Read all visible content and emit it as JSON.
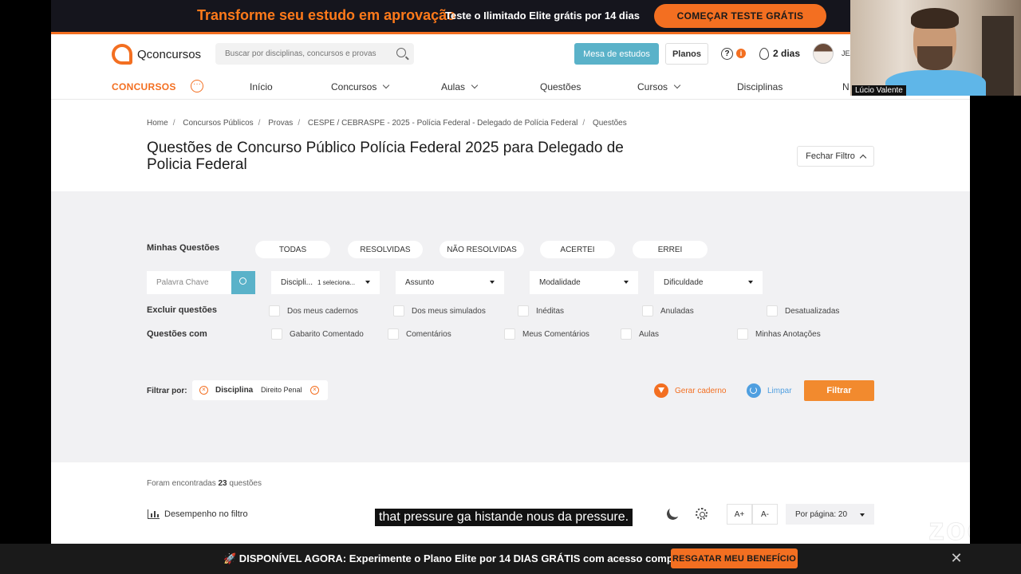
{
  "promo": {
    "title": "Transforme seu estudo em aprovação",
    "subtitle": "Teste o Ilimitado Elite grátis por 14 dias",
    "button": "COMEÇAR TESTE GRÁTIS"
  },
  "header": {
    "logo": "Qconcursos",
    "search_placeholder": "Buscar por disciplinas, concursos e provas",
    "mesa_button": "Mesa de estudos",
    "planos_button": "Planos",
    "streak": "2 dias",
    "user": "JEA"
  },
  "nav": {
    "active": "CONCURSOS",
    "items": [
      "Início",
      "Concursos",
      "Aulas",
      "Questões",
      "Cursos",
      "Disciplinas",
      "N"
    ]
  },
  "breadcrumb": [
    "Home",
    "Concursos Públicos",
    "Provas",
    "CESPE / CEBRASPE - 2025 - Polícia Federal - Delegado de Polícia Federal",
    "Questões"
  ],
  "page_title": "Questões de Concurso Público Polícia Federal 2025 para Delegado de Policia Federal",
  "fechar_filtro": "Fechar Filtro",
  "filters": {
    "minhas_label": "Minhas Questões",
    "minhas_options": [
      "TODAS",
      "RESOLVIDAS",
      "NÃO RESOLVIDAS",
      "ACERTEI",
      "ERREI"
    ],
    "keyword_placeholder": "Palavra Chave",
    "disciplina": "Discipli...",
    "disciplina_count": "1 seleciona...",
    "assunto": "Assunto",
    "modalidade": "Modalidade",
    "dificuldade": "Dificuldade",
    "excluir_label": "Excluir questões",
    "excluir_options": [
      "Dos meus cadernos",
      "Dos meus simulados",
      "Inéditas",
      "Anuladas",
      "Desatualizadas"
    ],
    "com_label": "Questões com",
    "com_options": [
      "Gabarito Comentado",
      "Comentários",
      "Meus Comentários",
      "Aulas",
      "Minhas Anotações"
    ],
    "filtrar_por": "Filtrar por:",
    "chip_main": "Disciplina",
    "chip_tag": "Direito Penal",
    "gerar": "Gerar caderno",
    "limpar": "Limpar",
    "filtrar_button": "Filtrar"
  },
  "results": {
    "found_prefix": "Foram encontradas",
    "found_count": "23",
    "found_suffix": "questões",
    "desempenho": "Desempenho no filtro",
    "font_up": "A+",
    "font_down": "A-",
    "per_page": "Por página: 20"
  },
  "caption": "that pressure ga histande nous da pressure.",
  "watermark": "zoom",
  "bottom": {
    "text": "🚀 DISPONÍVEL AGORA: Experimente o Plano Elite por 14 DIAS GRÁTIS com acesso completo.",
    "button": "RESGATAR MEU BENEFÍCIO"
  },
  "webcam": {
    "name": "Lúcio Valente"
  }
}
